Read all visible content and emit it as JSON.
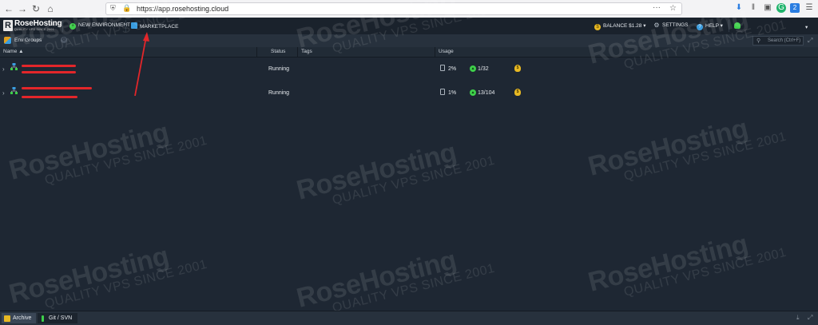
{
  "browser": {
    "url": "https://app.rosehosting.cloud",
    "menu_dots": "···",
    "extension_badge": "2"
  },
  "brand": {
    "name": "RoseHosting",
    "tagline": "QUALITY VPS SINCE 2001",
    "mark": "R"
  },
  "header": {
    "new_environment": "NEW ENVIRONMENT",
    "marketplace": "MARKETPLACE",
    "balance": "BALANCE $1.28",
    "settings": "SETTINGS",
    "help": "HELP"
  },
  "groups": {
    "label": "Env Groups",
    "search_placeholder": "Search (Ctrl+F)"
  },
  "columns": {
    "name": "Name ▲",
    "status": "Status",
    "tags": "Tags",
    "usage": "Usage"
  },
  "rows": [
    {
      "status": "Running",
      "disk": "2%",
      "cloudlets": "1/32"
    },
    {
      "status": "Running",
      "disk": "1%",
      "cloudlets": "13/104"
    }
  ],
  "bottom_tabs": [
    {
      "label": "Archive"
    },
    {
      "label": "Git / SVN"
    }
  ],
  "watermark": {
    "name": "RoseHosting",
    "tagline": "QUALITY VPS SINCE 2001"
  },
  "colors": {
    "background": "#1e2733",
    "header": "#1a222c",
    "running_green": "#3ecf4a",
    "billing_yellow": "#e8b923",
    "annotation_red": "#e3262a"
  }
}
